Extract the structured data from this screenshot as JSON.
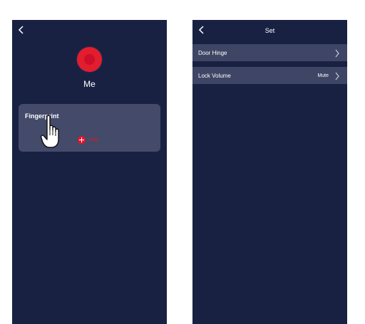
{
  "me_screen": {
    "avatar_name": "Me",
    "fingerprint_card": {
      "title": "Fingerprint",
      "add_label": "Add"
    }
  },
  "settings_screen": {
    "title": "Set",
    "rows": [
      {
        "label": "Door Hinge",
        "value": ""
      },
      {
        "label": "Lock Volume",
        "value": "Mute"
      }
    ]
  },
  "colors": {
    "background": "#192143",
    "card": "#434a6a",
    "row": "#3e4565",
    "accent_red": "#e0162b"
  },
  "icons": [
    "back-icon",
    "avatar-icon",
    "add-icon",
    "pointer-hand-icon",
    "chevron-right-icon"
  ]
}
